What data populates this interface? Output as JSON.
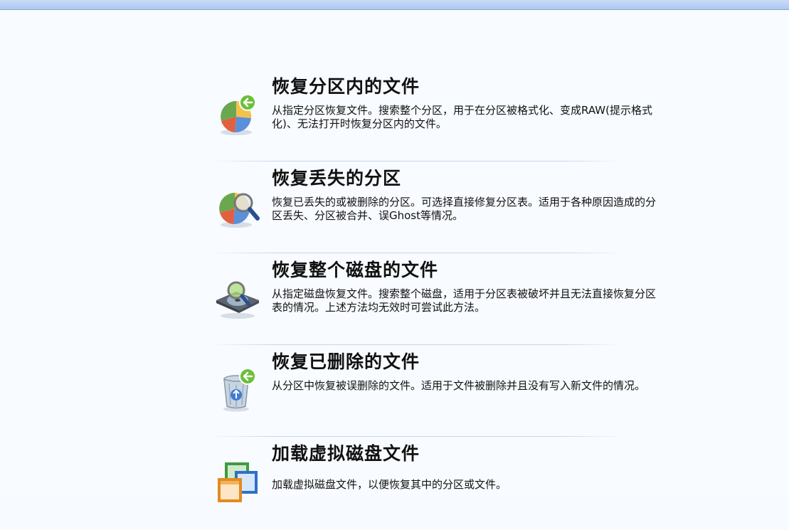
{
  "options": [
    {
      "title": "恢复分区内的文件",
      "desc": "从指定分区恢复文件。搜索整个分区，用于在分区被格式化、变成RAW(提示格式化)、无法打开时恢复分区内的文件。",
      "icon": "pie-chart-restore-icon"
    },
    {
      "title": "恢复丢失的分区",
      "desc": "恢复已丢失的或被删除的分区。可选择直接修复分区表。适用于各种原因造成的分区丢失、分区被合并、误Ghost等情况。",
      "icon": "pie-chart-search-icon"
    },
    {
      "title": "恢复整个磁盘的文件",
      "desc": "从指定磁盘恢复文件。搜索整个磁盘，适用于分区表被破坏并且无法直接恢复分区表的情况。上述方法均无效时可尝试此方法。",
      "icon": "disk-search-icon"
    },
    {
      "title": "恢复已删除的文件",
      "desc": "从分区中恢复被误删除的文件。适用于文件被删除并且没有写入新文件的情况。",
      "icon": "recycle-bin-restore-icon"
    },
    {
      "title": "加载虚拟磁盘文件",
      "desc": "加载虚拟磁盘文件，以便恢复其中的分区或文件。",
      "icon": "virtual-disk-icon"
    }
  ]
}
